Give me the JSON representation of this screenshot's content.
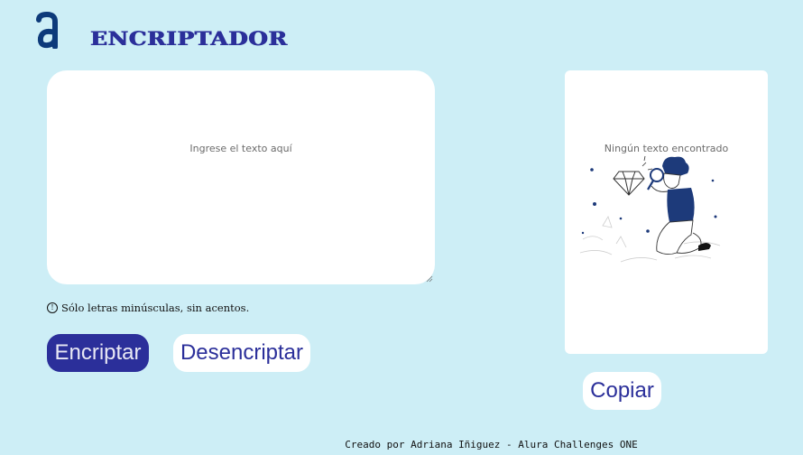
{
  "header": {
    "logo_icon": "alura-a-logo-icon",
    "title": "ENCRIPTADOR"
  },
  "input": {
    "placeholder": "Ingrese el texto aquí"
  },
  "hint": {
    "icon": "info-icon",
    "symbol": "!",
    "text": "Sólo letras minúsculas, sin acentos."
  },
  "buttons": {
    "encrypt_label": "Encriptar",
    "decrypt_label": "Desencriptar",
    "copy_label": "Copiar"
  },
  "output": {
    "empty_text": "Ningún texto encontrado",
    "illustration": "person-with-magnifier-illustration"
  },
  "footer": {
    "text": "Creado por Adriana Iñiguez - Alura Challenges ONE"
  },
  "colors": {
    "background": "#cdeef6",
    "primary": "#2b2f9a",
    "surface": "#ffffff"
  }
}
